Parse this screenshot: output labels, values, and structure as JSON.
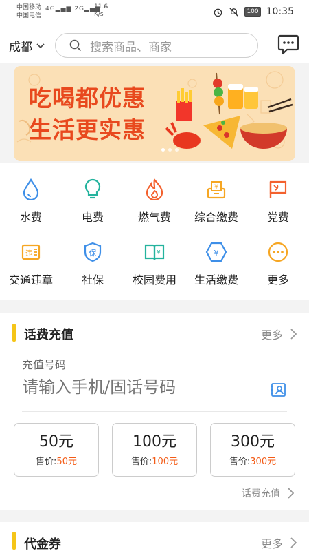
{
  "status": {
    "carrier1": "中国移动",
    "carrier2": "中国电信",
    "net1": "4G",
    "net2": "2G",
    "speed_value": "11.6",
    "speed_unit": "K/s",
    "battery": "100",
    "time": "10:35"
  },
  "header": {
    "city": "成都",
    "search_placeholder": "搜索商品、商家"
  },
  "banner": {
    "line1": "吃喝都优惠",
    "line2": "生活更实惠"
  },
  "services": [
    {
      "label": "水费",
      "icon": "water-drop-icon",
      "color": "#3e8fe8"
    },
    {
      "label": "电费",
      "icon": "lightbulb-icon",
      "color": "#25b39e"
    },
    {
      "label": "燃气费",
      "icon": "flame-icon",
      "color": "#f3612e"
    },
    {
      "label": "综合缴费",
      "icon": "payment-box-icon",
      "color": "#f6a623"
    },
    {
      "label": "党费",
      "icon": "party-flag-icon",
      "color": "#f3612e"
    },
    {
      "label": "交通违章",
      "icon": "traffic-ticket-icon",
      "color": "#f6a623"
    },
    {
      "label": "社保",
      "icon": "social-security-shield-icon",
      "color": "#3e8fe8"
    },
    {
      "label": "校园费用",
      "icon": "campus-book-icon",
      "color": "#25b39e"
    },
    {
      "label": "生活缴费",
      "icon": "living-payment-icon",
      "color": "#3e8fe8"
    },
    {
      "label": "更多",
      "icon": "more-dots-icon",
      "color": "#f6a623"
    }
  ],
  "recharge": {
    "title": "话费充值",
    "more": "更多",
    "phone_label": "充值号码",
    "phone_placeholder": "请输入手机/固话号码",
    "price_prefix": "售价:",
    "cards": [
      {
        "amount": "50元",
        "price": "50元"
      },
      {
        "amount": "100元",
        "price": "100元"
      },
      {
        "amount": "300元",
        "price": "300元"
      }
    ],
    "footer_link": "话费充值",
    "accent": "#f5c518",
    "price_color": "#f35b16"
  },
  "vouchers": {
    "title": "代金券",
    "more": "更多"
  }
}
